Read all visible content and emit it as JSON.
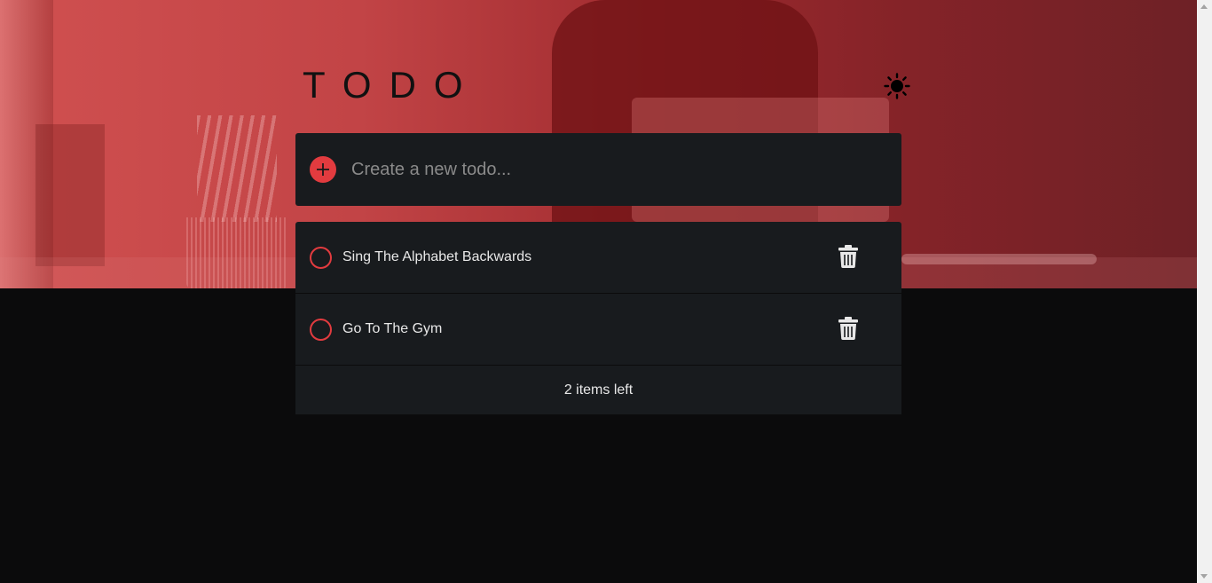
{
  "header": {
    "title": "TODO",
    "theme_icon": "sun-icon"
  },
  "new_todo": {
    "placeholder": "Create a new todo...",
    "value": "",
    "add_icon": "plus-icon"
  },
  "todos": [
    {
      "label": "Sing The Alphabet Backwards",
      "completed": false
    },
    {
      "label": "Go To The Gym",
      "completed": false
    }
  ],
  "footer": {
    "items_left": "2 items left"
  },
  "colors": {
    "accent": "#e23b3f",
    "card": "#181b1e",
    "page": "#0b0b0c",
    "hero": "#c24446"
  }
}
